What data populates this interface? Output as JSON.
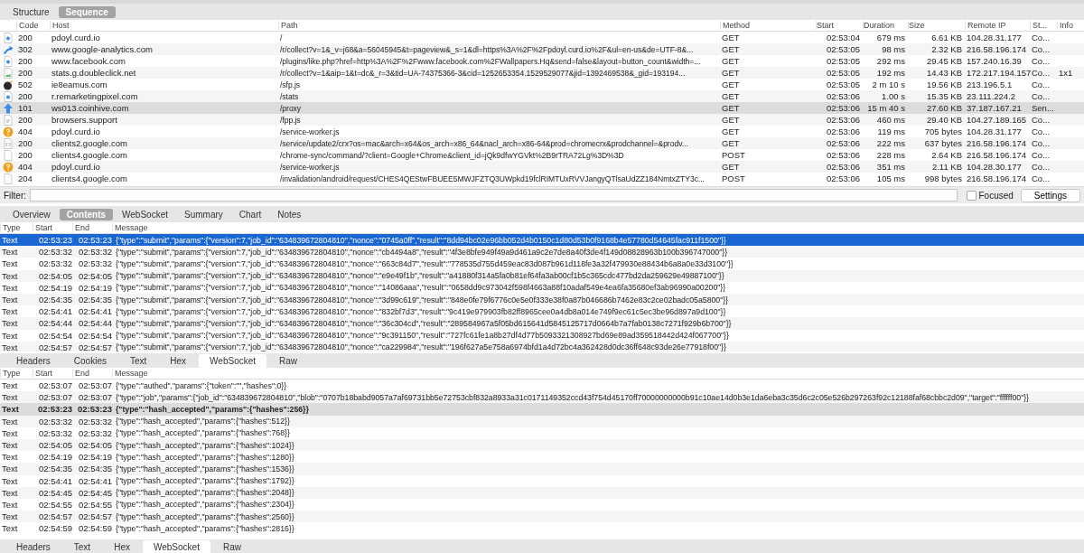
{
  "view_tabs": [
    {
      "label": "Structure",
      "selected": false
    },
    {
      "label": "Sequence",
      "selected": true
    }
  ],
  "requests": {
    "columns": [
      "Code",
      "Host",
      "Path",
      "Method",
      "Start",
      "Duration",
      "Size",
      "Remote IP",
      "St...",
      "Info"
    ],
    "rows": [
      {
        "kind": "page",
        "code": "200",
        "host": "pdoyl.curd.io",
        "path": "/",
        "method": "GET",
        "start": "02:53:04",
        "duration": "679 ms",
        "size": "6.61 KB",
        "remote_ip": "104.28.31.177",
        "status": "Co...",
        "selected": false
      },
      {
        "kind": "redirect",
        "code": "302",
        "host": "www.google-analytics.com",
        "path": "/r/collect?v=1&_v=j68&a=56045945&t=pageview&_s=1&dl=https%3A%2F%2Fpdoyl.curd.io%2F&ul=en-us&de=UTF-8&...",
        "method": "GET",
        "start": "02:53:05",
        "duration": "98 ms",
        "size": "2.32 KB",
        "remote_ip": "216.58.196.174",
        "status": "Co...",
        "selected": false
      },
      {
        "kind": "page",
        "code": "200",
        "host": "www.facebook.com",
        "path": "/plugins/like.php?href=http%3A%2F%2Fwww.facebook.com%2FWallpapers.Hq&send=false&layout=button_count&width=...",
        "method": "GET",
        "start": "02:53:05",
        "duration": "292 ms",
        "size": "29.45 KB",
        "remote_ip": "157.240.16.39",
        "status": "Co...",
        "selected": false
      },
      {
        "kind": "image",
        "code": "200",
        "host": "stats.g.doubleclick.net",
        "path": "/r/collect?v=1&aip=1&t=dc&_r=3&tid=UA-74375366-3&cid=1252653354.1529529077&jid=1392469538&_gid=193194...",
        "method": "GET",
        "start": "02:53:05",
        "duration": "192 ms",
        "size": "14.43 KB",
        "remote_ip": "172.217.194.157",
        "status": "Co...",
        "info": "1x1",
        "selected": false
      },
      {
        "kind": "bomb",
        "code": "502",
        "host": "ie8eamus.com",
        "path": "/sfp.js",
        "method": "GET",
        "start": "02:53:05",
        "duration": "2 m 10 s",
        "size": "19.56 KB",
        "remote_ip": "213.196.5.1",
        "status": "Co...",
        "selected": false
      },
      {
        "kind": "page",
        "code": "200",
        "host": "r.remarketingpixel.com",
        "path": "/stats",
        "method": "GET",
        "start": "02:53:06",
        "duration": "1.00 s",
        "size": "15.35 KB",
        "remote_ip": "23.111.224.2",
        "status": "Co...",
        "selected": false
      },
      {
        "kind": "upgrade",
        "code": "101",
        "host": "ws013.coinhive.com",
        "path": "/proxy",
        "method": "GET",
        "start": "02:53:06",
        "duration": "15 m 40 s",
        "size": "27.60 KB",
        "remote_ip": "37.187.167.21",
        "status": "Sen...",
        "selected": true
      },
      {
        "kind": "script",
        "code": "200",
        "host": "browsers.support",
        "path": "/fpp.js",
        "method": "GET",
        "start": "02:53:06",
        "duration": "460 ms",
        "size": "29.40 KB",
        "remote_ip": "104.27.189.165",
        "status": "Co...",
        "selected": false
      },
      {
        "kind": "alert",
        "code": "404",
        "host": "pdoyl.curd.io",
        "path": "/service-worker.js",
        "method": "GET",
        "start": "02:53:06",
        "duration": "119 ms",
        "size": "705 bytes",
        "remote_ip": "104.28.31.177",
        "status": "Co...",
        "selected": false
      },
      {
        "kind": "code",
        "code": "200",
        "host": "clients2.google.com",
        "path": "/service/update2/crx?os=mac&arch=x64&os_arch=x86_64&nacl_arch=x86-64&prod=chromecrx&prodchannel=&prodv...",
        "method": "GET",
        "start": "02:53:06",
        "duration": "222 ms",
        "size": "637 bytes",
        "remote_ip": "216.58.196.174",
        "status": "Co...",
        "selected": false
      },
      {
        "kind": "file",
        "code": "200",
        "host": "clients4.google.com",
        "path": "/chrome-sync/command/?client=Google+Chrome&client_id=jQk9dfwYGVkt%2B9rTRA72Lg%3D%3D",
        "method": "POST",
        "start": "02:53:06",
        "duration": "228 ms",
        "size": "2.64 KB",
        "remote_ip": "216.58.196.174",
        "status": "Co...",
        "selected": false
      },
      {
        "kind": "alert",
        "code": "404",
        "host": "pdoyl.curd.io",
        "path": "/service-worker.js",
        "method": "GET",
        "start": "02:53:06",
        "duration": "351 ms",
        "size": "2.11 KB",
        "remote_ip": "104.28.30.177",
        "status": "Co...",
        "selected": false
      },
      {
        "kind": "file",
        "code": "204",
        "host": "clients4.google.com",
        "path": "/invalidation/android/request/CHES4QEStwFBUEE5MWJFZTQ3UWpkd19fclRIMTUxRVVJangyQTlsaUdZZ184NmtxZTY3c...",
        "method": "POST",
        "start": "02:53:06",
        "duration": "105 ms",
        "size": "998 bytes",
        "remote_ip": "216.58.196.174",
        "status": "Co...",
        "selected": false
      }
    ]
  },
  "filter": {
    "label": "Filter:",
    "focused": {
      "label": "Focused",
      "checked": false
    },
    "settings": "Settings"
  },
  "detail_tabs": [
    {
      "label": "Overview",
      "selected": false
    },
    {
      "label": "Contents",
      "selected": true
    },
    {
      "label": "WebSocket",
      "selected": false
    },
    {
      "label": "Summary",
      "selected": false
    },
    {
      "label": "Chart",
      "selected": false
    },
    {
      "label": "Notes",
      "selected": false
    }
  ],
  "contents": {
    "columns": [
      "Type",
      "Start",
      "End",
      "Message"
    ],
    "rows": [
      {
        "type": "Text",
        "start": "02:53:23",
        "end": "02:53:23",
        "message": "{\"type\":\"submit\",\"params\":{\"version\":7,\"job_id\":\"634839672804810\",\"nonce\":\"0745a0ff\",\"result\":\"8dd94bc02e96bb052d4b0150c1d80d53b0f9168b4e57780d54645fac911f1500\"}}",
        "selected": true
      },
      {
        "type": "Text",
        "start": "02:53:32",
        "end": "02:53:32",
        "message": "{\"type\":\"submit\",\"params\":{\"version\":7,\"job_id\":\"634839672804810\",\"nonce\":\"cb4494a8\",\"result\":\"4f3e8bfe949f49a9d461a9c2e7de8a40f3de4f149d08828963b100b396747000\"}}",
        "selected": false
      },
      {
        "type": "Text",
        "start": "02:53:32",
        "end": "02:53:32",
        "message": "{\"type\":\"submit\",\"params\":{\"version\":7,\"job_id\":\"634839672804810\",\"nonce\":\"663c84d7\",\"result\":\"778535d755d459eac83d087b961d118fe3a32f479930e88434b6a8a0e33d3100\"}}",
        "selected": false
      },
      {
        "type": "Text",
        "start": "02:54:05",
        "end": "02:54:05",
        "message": "{\"type\":\"submit\",\"params\":{\"version\":7,\"job_id\":\"634839672804810\",\"nonce\":\"e9e49f1b\",\"result\":\"a41880f314a5fa0b81ef64fa3ab00cf1b5c365cdc477bd2da259629e49887100\"}}",
        "selected": false
      },
      {
        "type": "Text",
        "start": "02:54:19",
        "end": "02:54:19",
        "message": "{\"type\":\"submit\",\"params\":{\"version\":7,\"job_id\":\"634839672804810\",\"nonce\":\"14086aaa\",\"result\":\"0658dd9c973042f598f4663a88f10adaf549e4ea6fa35680ef3ab96990a00200\"}}",
        "selected": false
      },
      {
        "type": "Text",
        "start": "02:54:35",
        "end": "02:54:35",
        "message": "{\"type\":\"submit\",\"params\":{\"version\":7,\"job_id\":\"634839672804810\",\"nonce\":\"3d99c619\",\"result\":\"848e0fe79f6776c0e5e0f333e38f0a87b046686b7462e83c2ce02badc05a5800\"}}",
        "selected": false
      },
      {
        "type": "Text",
        "start": "02:54:41",
        "end": "02:54:41",
        "message": "{\"type\":\"submit\",\"params\":{\"version\":7,\"job_id\":\"634839672804810\",\"nonce\":\"832bf7d3\",\"result\":\"9c419e979903fb82ff8965cee0a4db8a014e749f9ec61c5ec3be96d897a9d100\"}}",
        "selected": false
      },
      {
        "type": "Text",
        "start": "02:54:44",
        "end": "02:54:44",
        "message": "{\"type\":\"submit\",\"params\":{\"version\":7,\"job_id\":\"634839672804810\",\"nonce\":\"36c304cd\",\"result\":\"289584967a5f05bd615641d5845125717d0664b7a7fab0138c7271f929b6b700\"}}",
        "selected": false
      },
      {
        "type": "Text",
        "start": "02:54:54",
        "end": "02:54:54",
        "message": "{\"type\":\"submit\",\"params\":{\"version\":7,\"job_id\":\"634839672804810\",\"nonce\":\"9c391150\",\"result\":\"727fc61fe1a8b27df4d77b5093321308927bd69e89ad359518442d424f067700\"}}",
        "selected": false
      },
      {
        "type": "Text",
        "start": "02:54:57",
        "end": "02:54:57",
        "message": "{\"type\":\"submit\",\"params\":{\"version\":7,\"job_id\":\"634839672804810\",\"nonce\":\"ca229984\",\"result\":\"196f627a5e758a6974bfd1a4d72bc4a362428d0dc36ff648c93de26e77918f00\"}}",
        "selected": false
      }
    ]
  },
  "request_tabs": [
    {
      "label": "Headers",
      "selected": false
    },
    {
      "label": "Cookies",
      "selected": false
    },
    {
      "label": "Text",
      "selected": false
    },
    {
      "label": "Hex",
      "selected": false
    },
    {
      "label": "WebSocket",
      "selected": true
    },
    {
      "label": "Raw",
      "selected": false
    }
  ],
  "frames": {
    "columns": [
      "Type",
      "Start",
      "End",
      "Message"
    ],
    "rows": [
      {
        "type": "Text",
        "start": "02:53:07",
        "end": "02:53:07",
        "message": "{\"type\":\"authed\",\"params\":{\"token\":\"\",\"hashes\":0}}",
        "selected": false
      },
      {
        "type": "Text",
        "start": "02:53:07",
        "end": "02:53:07",
        "message": "{\"type\":\"job\",\"params\":{\"job_id\":\"634839672804810\",\"blob\":\"0707b18babd9057a7af69731bb5e72753cbf832a8933a31c0171149352ccd43f754d45170ff70000000000b91c10ae14d0b3e1da6eba3c35d6c2c05e526b297263f92c12188faf68cbbc2d09\",\"target\":\"ffffff00\"}}",
        "selected": false
      },
      {
        "type": "Text",
        "start": "02:53:23",
        "end": "02:53:23",
        "message": "{\"type\":\"hash_accepted\",\"params\":{\"hashes\":256}}",
        "selected": true
      },
      {
        "type": "Text",
        "start": "02:53:32",
        "end": "02:53:32",
        "message": "{\"type\":\"hash_accepted\",\"params\":{\"hashes\":512}}",
        "selected": false
      },
      {
        "type": "Text",
        "start": "02:53:32",
        "end": "02:53:32",
        "message": "{\"type\":\"hash_accepted\",\"params\":{\"hashes\":768}}",
        "selected": false
      },
      {
        "type": "Text",
        "start": "02:54:05",
        "end": "02:54:05",
        "message": "{\"type\":\"hash_accepted\",\"params\":{\"hashes\":1024}}",
        "selected": false
      },
      {
        "type": "Text",
        "start": "02:54:19",
        "end": "02:54:19",
        "message": "{\"type\":\"hash_accepted\",\"params\":{\"hashes\":1280}}",
        "selected": false
      },
      {
        "type": "Text",
        "start": "02:54:35",
        "end": "02:54:35",
        "message": "{\"type\":\"hash_accepted\",\"params\":{\"hashes\":1536}}",
        "selected": false
      },
      {
        "type": "Text",
        "start": "02:54:41",
        "end": "02:54:41",
        "message": "{\"type\":\"hash_accepted\",\"params\":{\"hashes\":1792}}",
        "selected": false
      },
      {
        "type": "Text",
        "start": "02:54:45",
        "end": "02:54:45",
        "message": "{\"type\":\"hash_accepted\",\"params\":{\"hashes\":2048}}",
        "selected": false
      },
      {
        "type": "Text",
        "start": "02:54:55",
        "end": "02:54:55",
        "message": "{\"type\":\"hash_accepted\",\"params\":{\"hashes\":2304}}",
        "selected": false
      },
      {
        "type": "Text",
        "start": "02:54:57",
        "end": "02:54:57",
        "message": "{\"type\":\"hash_accepted\",\"params\":{\"hashes\":2560}}",
        "selected": false
      },
      {
        "type": "Text",
        "start": "02:54:59",
        "end": "02:54:59",
        "message": "{\"type\":\"hash_accepted\",\"params\":{\"hashes\":2816}}",
        "selected": false
      }
    ]
  },
  "response_tabs": [
    {
      "label": "Headers",
      "selected": false
    },
    {
      "label": "Text",
      "selected": false
    },
    {
      "label": "Hex",
      "selected": false
    },
    {
      "label": "WebSocket",
      "selected": true
    },
    {
      "label": "Raw",
      "selected": false
    }
  ]
}
